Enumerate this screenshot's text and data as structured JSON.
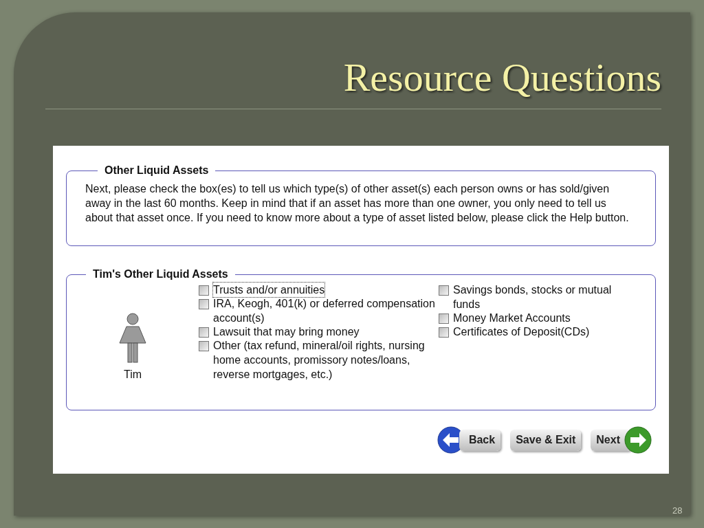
{
  "slide": {
    "title": "Resource Questions",
    "page_number": "28"
  },
  "intro": {
    "legend": "Other Liquid Assets",
    "text": "Next, please check the box(es) to tell us which type(s) of other asset(s) each person owns or has sold/given away in the last 60 months. Keep in mind that if an asset has more than one owner, you only need to tell us about that asset once. If you need to know more about a type of asset listed below, please click the Help button."
  },
  "assets": {
    "legend": "Tim's Other Liquid Assets",
    "person": "Tim",
    "columns": [
      [
        {
          "label": "Trusts and/or annuities",
          "checked": false,
          "focused": true
        },
        {
          "label": "IRA, Keogh, 401(k) or deferred compensation account(s)",
          "checked": false,
          "focused": false
        },
        {
          "label": "Lawsuit that may bring money",
          "checked": false,
          "focused": false
        },
        {
          "label": "Other (tax refund, mineral/oil rights, nursing home accounts, promissory notes/loans, reverse mortgages, etc.)",
          "checked": false,
          "focused": false
        }
      ],
      [
        {
          "label": "Savings bonds, stocks or mutual funds",
          "checked": false,
          "focused": false
        },
        {
          "label": "Money Market Accounts",
          "checked": false,
          "focused": false
        },
        {
          "label": "Certificates of Deposit(CDs)",
          "checked": false,
          "focused": false
        }
      ]
    ]
  },
  "buttons": [
    {
      "label": "Back",
      "kind": "back"
    },
    {
      "label": "Save & Exit",
      "kind": "plain"
    },
    {
      "label": "Next",
      "kind": "next"
    }
  ]
}
